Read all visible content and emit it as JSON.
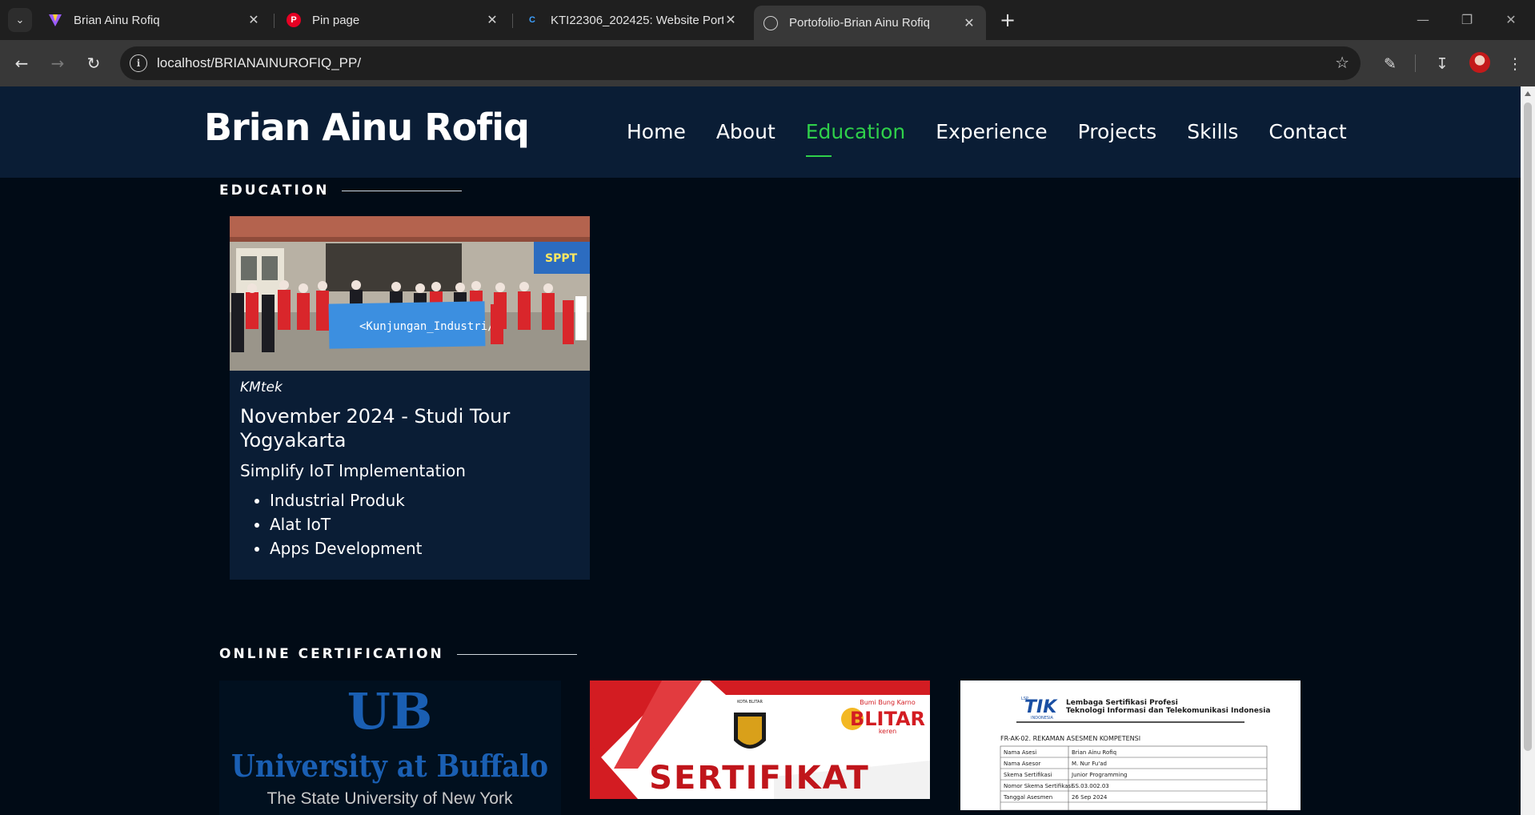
{
  "browser": {
    "tabs": [
      {
        "label": "Brian Ainu Rofiq"
      },
      {
        "label": "Pin page"
      },
      {
        "label": "KTI22306_202425: Website Portofolio"
      },
      {
        "label": "Portofolio-Brian Ainu Rofiq"
      }
    ],
    "url": "localhost/BRIANAINUROFIQ_PP/"
  },
  "site": {
    "brand": "Brian Ainu Rofiq",
    "nav": [
      "Home",
      "About",
      "Education",
      "Experience",
      "Projects",
      "Skills",
      "Contact"
    ],
    "active_nav": "Education"
  },
  "education": {
    "title": "EDUCATION",
    "card": {
      "banner_text": "<Kunjungan_Industri/>",
      "sign_text": "SPPT",
      "organization": "KMtek",
      "heading": "November 2024 - Studi Tour Yogyakarta",
      "subtitle": "Simplify IoT Implementation",
      "items": [
        "Industrial Produk",
        "Alat IoT",
        "Apps Development"
      ]
    }
  },
  "certification": {
    "title": "ONLINE CERTIFICATION",
    "ub": {
      "logo": "UB",
      "name": "University at Buffalo",
      "sub": "The State University of New York"
    },
    "blitar": {
      "city": "KOTA BLITAR",
      "tag": "Bumi Bung Karno",
      "brand": "BLITAR",
      "brand_sub": "keren",
      "title": "SERTIFIKAT"
    },
    "lsp": {
      "logo": "TIK",
      "logo_sub": "INDONESIA",
      "lsp_label": "LSP",
      "org_line1": "Lembaga Sertifikasi Profesi",
      "org_line2": "Teknologi Informasi dan Telekomunikasi Indonesia",
      "form_title": "FR-AK-02. REKAMAN ASESMEN KOMPETENSI",
      "rows": [
        [
          "Nama Asesi",
          "Brian Ainu Rofiq"
        ],
        [
          "Nama Asesor",
          "M. Nur Fu'ad"
        ],
        [
          "Skema Sertifikasi",
          "Junior Programming"
        ],
        [
          "Nomor Skema Sertifikasi",
          "SS.03.002.03"
        ],
        [
          "Tanggal Asesmen",
          "26 Sep 2024"
        ]
      ]
    }
  },
  "colors": {
    "header_bg": "#0a1d35",
    "page_bg": "#010b16",
    "accent": "#2fd04a"
  }
}
